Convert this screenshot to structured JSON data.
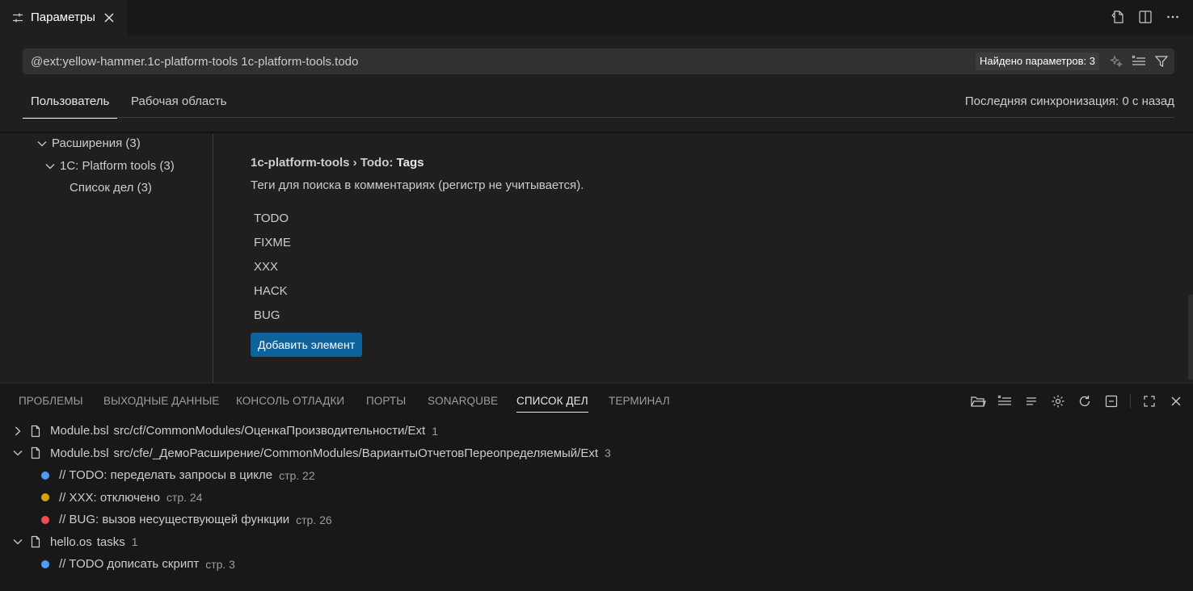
{
  "editor_tab": {
    "title": "Параметры"
  },
  "search": {
    "value": "@ext:yellow-hammer.1c-platform-tools 1c-platform-tools.todo",
    "found": "Найдено параметров: 3"
  },
  "scope": {
    "user": "Пользователь",
    "workspace": "Рабочая область",
    "sync": "Последняя синхронизация: 0 с назад"
  },
  "toc": {
    "extensions": "Расширения (3)",
    "platform_tools": "1C: Platform tools (3)",
    "todo_list": "Список дел (3)"
  },
  "setting": {
    "category": "1c-platform-tools › Todo: ",
    "name": "Tags",
    "description": "Теги для поиска в комментариях (регистр не учитывается).",
    "tags": [
      "TODO",
      "FIXME",
      "XXX",
      "HACK",
      "BUG"
    ],
    "add_button": "Добавить элемент"
  },
  "panel": {
    "tabs": [
      "ПРОБЛЕМЫ",
      "ВЫХОДНЫЕ ДАННЫЕ",
      "КОНСОЛЬ ОТЛАДКИ",
      "ПОРТЫ",
      "SONARQUBE",
      "СПИСОК ДЕЛ",
      "ТЕРМИНАЛ"
    ],
    "active_tab": "СПИСОК ДЕЛ"
  },
  "todo_tree": {
    "file1": {
      "name": "Module.bsl",
      "path": "src/cf/CommonModules/ОценкаПроизводительности/Ext",
      "count": "1"
    },
    "file2": {
      "name": "Module.bsl",
      "path": "src/cfe/_ДемоРасширение/CommonModules/ВариантыОтчетовПереопределяемый/Ext",
      "count": "3"
    },
    "file2_items": [
      {
        "text": "// TODO: переделать запросы в цикле",
        "line": "стр. 22",
        "color": "#4d9cf6"
      },
      {
        "text": "// XXX: отключено",
        "line": "стр. 24",
        "color": "#d2a40c"
      },
      {
        "text": "// BUG: вызов несуществующей функции",
        "line": "стр. 26",
        "color": "#f14c4c"
      }
    ],
    "file3": {
      "name": "hello.os",
      "path": "tasks",
      "count": "1"
    },
    "file3_items": [
      {
        "text": "// TODO дописать скрипт",
        "line": "стр. 3",
        "color": "#4d9cf6"
      }
    ]
  },
  "colors": {
    "accent_button": "#0e639c",
    "background": "#1f1f1f",
    "panel": "#181818"
  }
}
